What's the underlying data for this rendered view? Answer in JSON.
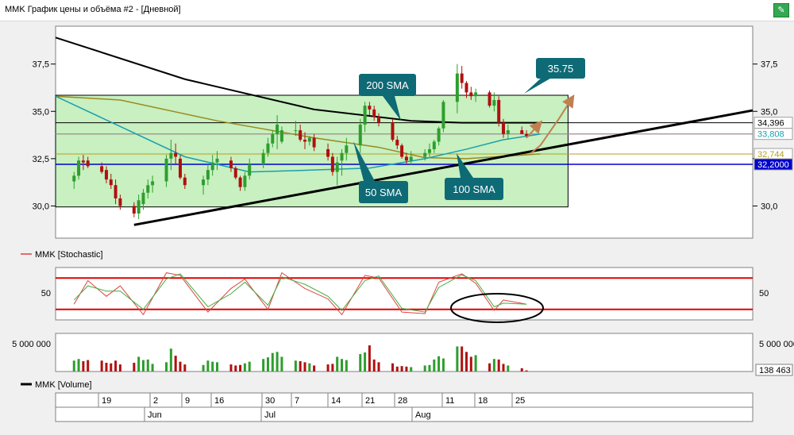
{
  "window": {
    "title": "MMK График цены и объёма #2 - [Дневной]"
  },
  "price_panel": {
    "y_ticks": [
      "37,5",
      "35,0",
      "32,5",
      "30,0"
    ],
    "price_labels": [
      {
        "text": "34,396",
        "value": 34.396,
        "color": "#000000",
        "bg": "#ffffff"
      },
      {
        "text": "33,808",
        "value": 33.808,
        "color": "#1a9fb0",
        "bg": "#ffffff"
      },
      {
        "text": "32,744",
        "value": 32.744,
        "color": "#b8a020",
        "bg": "#ffffff"
      },
      {
        "text": "32,2000",
        "value": 32.2,
        "color": "#ffffff",
        "bg": "#0000cc"
      }
    ],
    "annotations": {
      "sma200": "200 SMA",
      "sma50": "50 SMA",
      "sma100": "100 SMA",
      "target": "35.75"
    }
  },
  "stoch_panel": {
    "legend": "MMK [Stochastic]",
    "y_tick": "50",
    "upper": 80,
    "lower": 20
  },
  "volume_panel": {
    "legend": "MMK [Volume]",
    "y_tick": "5 000 000",
    "right_tick": "5 000 000",
    "last_label": "138 463"
  },
  "date_axis": {
    "days": [
      "19",
      "2",
      "9",
      "16",
      "30",
      "7",
      "14",
      "21",
      "28",
      "11",
      "18",
      "25"
    ],
    "months": [
      "Jun",
      "Jul",
      "Aug"
    ]
  },
  "colors": {
    "up": "#2e9e2e",
    "down": "#b01010",
    "sma200": "#000000",
    "sma100": "#9a8a20",
    "sma50": "#1a9fb0",
    "box": "#c8f0c0",
    "annotation": "#0e6a75",
    "arrow": "#c08050"
  },
  "chart_data": [
    {
      "type": "candlestick",
      "title": "MMK График цены и объёма #2 - [Дневной]",
      "ylim": [
        28.3,
        39.5
      ],
      "x": [
        "2023-05-16",
        "2023-05-17",
        "2023-05-18",
        "2023-05-19",
        "2023-05-22",
        "2023-05-23",
        "2023-05-24",
        "2023-05-25",
        "2023-05-26",
        "2023-05-29",
        "2023-05-30",
        "2023-05-31",
        "2023-06-01",
        "2023-06-02",
        "2023-06-05",
        "2023-06-06",
        "2023-06-07",
        "2023-06-08",
        "2023-06-09",
        "2023-06-13",
        "2023-06-14",
        "2023-06-15",
        "2023-06-16",
        "2023-06-19",
        "2023-06-20",
        "2023-06-21",
        "2023-06-22",
        "2023-06-23",
        "2023-06-26",
        "2023-06-27",
        "2023-06-28",
        "2023-06-29",
        "2023-06-30",
        "2023-07-03",
        "2023-07-04",
        "2023-07-05",
        "2023-07-06",
        "2023-07-07",
        "2023-07-10",
        "2023-07-11",
        "2023-07-12",
        "2023-07-13",
        "2023-07-14",
        "2023-07-17",
        "2023-07-18",
        "2023-07-19",
        "2023-07-20",
        "2023-07-21",
        "2023-07-24",
        "2023-07-25",
        "2023-07-26",
        "2023-07-27",
        "2023-07-28",
        "2023-07-31",
        "2023-08-01",
        "2023-08-02",
        "2023-08-03",
        "2023-08-04",
        "2023-08-07",
        "2023-08-08",
        "2023-08-09",
        "2023-08-10",
        "2023-08-11",
        "2023-08-14",
        "2023-08-15",
        "2023-08-16",
        "2023-08-17",
        "2023-08-18",
        "2023-08-21",
        "2023-08-22"
      ],
      "open": [
        31.3,
        31.6,
        32.4,
        32.4,
        32.1,
        31.9,
        31.4,
        31.1,
        30.4,
        30.0,
        29.6,
        30.1,
        30.7,
        31.1,
        31.3,
        32.5,
        32.8,
        32.5,
        31.5,
        31.1,
        31.4,
        31.9,
        32.3,
        32.4,
        32.0,
        31.5,
        31.0,
        31.6,
        32.2,
        32.8,
        33.3,
        33.8,
        33.4,
        34.0,
        34.0,
        33.5,
        33.4,
        33.6,
        33.0,
        32.6,
        31.8,
        32.4,
        32.8,
        33.2,
        34.3,
        35.3,
        35.1,
        34.7,
        34.4,
        33.5,
        33.2,
        32.6,
        32.4,
        32.6,
        32.8,
        33.0,
        33.4,
        34.1,
        35.5,
        37.0,
        36.5,
        36.0,
        35.8,
        36.0,
        35.3,
        35.6,
        34.4,
        33.8,
        34.0,
        33.8
      ],
      "high": [
        31.8,
        32.6,
        32.7,
        32.6,
        32.3,
        32.1,
        31.7,
        31.4,
        30.6,
        30.2,
        30.6,
        30.9,
        31.4,
        31.6,
        32.7,
        33.5,
        33.3,
        32.7,
        31.7,
        31.6,
        32.2,
        32.7,
        32.9,
        32.6,
        32.1,
        31.6,
        31.8,
        32.5,
        33.0,
        33.6,
        34.0,
        34.8,
        34.2,
        34.5,
        34.3,
        33.9,
        33.7,
        33.8,
        33.3,
        32.8,
        32.6,
        33.0,
        33.6,
        34.6,
        35.5,
        35.5,
        35.3,
        34.9,
        34.6,
        33.7,
        33.3,
        32.8,
        32.9,
        33.0,
        33.3,
        33.5,
        34.2,
        35.6,
        37.5,
        37.4,
        36.6,
        36.3,
        36.2,
        36.1,
        36.0,
        35.8,
        34.6,
        34.3,
        34.2,
        34.0
      ],
      "low": [
        30.9,
        31.4,
        31.9,
        32.0,
        31.7,
        31.2,
        30.9,
        30.1,
        29.8,
        29.4,
        29.3,
        29.8,
        30.4,
        30.7,
        31.0,
        31.9,
        32.2,
        31.4,
        30.9,
        30.6,
        31.1,
        31.6,
        31.9,
        31.8,
        31.4,
        30.8,
        30.8,
        31.4,
        32.0,
        32.6,
        33.1,
        33.0,
        33.3,
        33.7,
        33.4,
        33.0,
        33.2,
        32.9,
        32.4,
        31.6,
        31.1,
        31.6,
        32.4,
        32.8,
        33.9,
        34.8,
        34.5,
        34.2,
        33.4,
        33.0,
        32.5,
        32.2,
        32.2,
        32.4,
        32.6,
        32.8,
        33.2,
        33.9,
        34.9,
        36.2,
        35.7,
        35.6,
        35.5,
        35.2,
        35.0,
        34.2,
        33.6,
        33.5,
        33.8,
        33.6
      ],
      "close": [
        31.6,
        32.4,
        32.3,
        32.1,
        31.8,
        31.4,
        31.1,
        30.4,
        30.0,
        29.6,
        30.3,
        30.7,
        31.1,
        31.3,
        32.5,
        32.8,
        32.6,
        31.5,
        31.1,
        31.4,
        31.9,
        32.3,
        32.5,
        32.0,
        31.5,
        31.0,
        31.6,
        32.2,
        32.8,
        33.3,
        33.8,
        34.3,
        34.0,
        34.0,
        33.5,
        33.4,
        33.6,
        33.1,
        32.6,
        31.8,
        32.3,
        32.8,
        33.2,
        34.3,
        35.3,
        35.1,
        34.7,
        34.4,
        33.5,
        33.2,
        32.6,
        32.4,
        32.6,
        32.8,
        33.0,
        33.4,
        34.1,
        35.5,
        37.0,
        36.5,
        36.0,
        35.8,
        36.0,
        35.3,
        35.6,
        34.4,
        33.8,
        34.0,
        33.8,
        33.7
      ],
      "trendline": [
        [
          "2023-05-29",
          29.0
        ],
        [
          "2023-10-10",
          35.05
        ]
      ],
      "horizontal_levels": [
        34.396,
        33.808,
        32.744,
        32.2
      ],
      "box": {
        "x0": "2023-05-12",
        "x1": "2023-08-31",
        "y0": 29.95,
        "y1": 35.85
      },
      "series": [
        {
          "name": "200 SMA",
          "color": "#000000",
          "x": [
            "2023-05-12",
            "2023-06-09",
            "2023-07-07",
            "2023-07-28",
            "2023-08-08",
            "2023-08-25"
          ],
          "values": [
            38.9,
            36.7,
            35.1,
            34.5,
            34.4,
            34.4
          ]
        },
        {
          "name": "100 SMA",
          "color": "#9a8a20",
          "x": [
            "2023-05-12",
            "2023-05-26",
            "2023-06-16",
            "2023-07-07",
            "2023-07-21",
            "2023-07-31",
            "2023-08-09",
            "2023-08-25"
          ],
          "values": [
            35.8,
            35.6,
            34.5,
            33.6,
            33.1,
            32.55,
            32.5,
            32.75
          ]
        },
        {
          "name": "50 SMA",
          "color": "#1a9fb0",
          "x": [
            "2023-05-12",
            "2023-05-26",
            "2023-06-09",
            "2023-06-23",
            "2023-07-07",
            "2023-07-19",
            "2023-07-31",
            "2023-08-09",
            "2023-08-17",
            "2023-08-25"
          ],
          "values": [
            35.8,
            34.2,
            32.6,
            31.8,
            31.9,
            32.0,
            32.5,
            33.0,
            33.5,
            33.8
          ]
        }
      ],
      "projection": {
        "path1": [
          [
            "2023-08-22",
            33.6
          ],
          [
            "2023-08-25",
            34.4
          ]
        ],
        "path2": [
          [
            "2023-08-23",
            32.8
          ],
          [
            "2023-08-25",
            33.2
          ],
          [
            "2023-08-29",
            34.6
          ],
          [
            "2023-09-01",
            35.75
          ]
        ]
      }
    },
    {
      "type": "line",
      "title": "MMK [Stochastic]",
      "ylim": [
        0,
        100
      ],
      "levels": [
        80,
        20
      ],
      "x": [
        "2023-05-16",
        "2023-05-19",
        "2023-05-23",
        "2023-05-26",
        "2023-05-31",
        "2023-06-05",
        "2023-06-08",
        "2023-06-14",
        "2023-06-19",
        "2023-06-22",
        "2023-06-27",
        "2023-06-30",
        "2023-07-05",
        "2023-07-10",
        "2023-07-13",
        "2023-07-18",
        "2023-07-21",
        "2023-07-26",
        "2023-07-31",
        "2023-08-03",
        "2023-08-08",
        "2023-08-11",
        "2023-08-15",
        "2023-08-17",
        "2023-08-22"
      ],
      "series": [
        {
          "name": "%K",
          "color": "#e04040",
          "values": [
            30,
            75,
            45,
            65,
            10,
            90,
            85,
            15,
            60,
            78,
            20,
            90,
            60,
            40,
            10,
            85,
            80,
            15,
            12,
            72,
            88,
            70,
            18,
            38,
            30
          ]
        },
        {
          "name": "%D",
          "color": "#40b040",
          "values": [
            38,
            65,
            55,
            55,
            20,
            78,
            88,
            25,
            50,
            72,
            28,
            82,
            68,
            45,
            18,
            75,
            84,
            22,
            15,
            62,
            86,
            75,
            25,
            32,
            30
          ]
        }
      ]
    },
    {
      "type": "bar",
      "title": "MMK [Volume]",
      "ylim": [
        0,
        7000000
      ],
      "x": [
        "2023-05-16",
        "2023-05-17",
        "2023-05-18",
        "2023-05-19",
        "2023-05-22",
        "2023-05-23",
        "2023-05-24",
        "2023-05-25",
        "2023-05-26",
        "2023-05-29",
        "2023-05-30",
        "2023-05-31",
        "2023-06-01",
        "2023-06-02",
        "2023-06-05",
        "2023-06-06",
        "2023-06-07",
        "2023-06-08",
        "2023-06-09",
        "2023-06-13",
        "2023-06-14",
        "2023-06-15",
        "2023-06-16",
        "2023-06-19",
        "2023-06-20",
        "2023-06-21",
        "2023-06-22",
        "2023-06-23",
        "2023-06-26",
        "2023-06-27",
        "2023-06-28",
        "2023-06-29",
        "2023-06-30",
        "2023-07-03",
        "2023-07-04",
        "2023-07-05",
        "2023-07-06",
        "2023-07-07",
        "2023-07-10",
        "2023-07-11",
        "2023-07-12",
        "2023-07-13",
        "2023-07-14",
        "2023-07-17",
        "2023-07-18",
        "2023-07-19",
        "2023-07-20",
        "2023-07-21",
        "2023-07-24",
        "2023-07-25",
        "2023-07-26",
        "2023-07-27",
        "2023-07-28",
        "2023-07-31",
        "2023-08-01",
        "2023-08-02",
        "2023-08-03",
        "2023-08-04",
        "2023-08-07",
        "2023-08-08",
        "2023-08-09",
        "2023-08-10",
        "2023-08-11",
        "2023-08-14",
        "2023-08-15",
        "2023-08-16",
        "2023-08-17",
        "2023-08-18",
        "2023-08-21",
        "2023-08-22"
      ],
      "values": [
        2000000,
        2300000,
        1900000,
        2100000,
        2000000,
        1600000,
        1500000,
        2000000,
        1300000,
        1600000,
        2700000,
        2100000,
        2200000,
        1400000,
        1700000,
        4200000,
        2900000,
        1800000,
        1300000,
        1200000,
        2000000,
        1800000,
        1700000,
        1300000,
        1100000,
        1200000,
        1500000,
        1800000,
        2300000,
        2600000,
        3400000,
        3600000,
        2700000,
        2000000,
        1900000,
        1700000,
        1500000,
        1100000,
        1300000,
        1400000,
        2700000,
        2300000,
        2100000,
        3200000,
        3500000,
        4800000,
        2200000,
        1700000,
        1500000,
        900000,
        1000000,
        900000,
        800000,
        1100000,
        1200000,
        2200000,
        2800000,
        2400000,
        4600000,
        4600000,
        3600000,
        2700000,
        3000000,
        1500000,
        2300000,
        2200000,
        1400000,
        1100000,
        600000,
        200000
      ],
      "last": 138463
    }
  ]
}
